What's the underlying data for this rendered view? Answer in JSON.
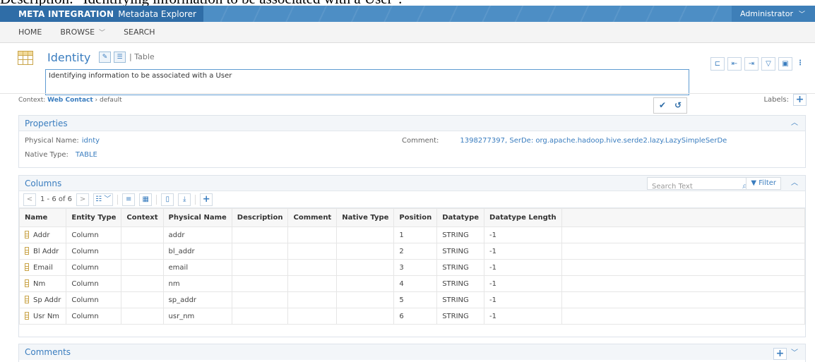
{
  "cropped_caption": "Description: \"Identifying information to be associated with a User\".",
  "app": {
    "brand_strong": "META INTEGRATION",
    "brand_sub": "Metadata Explorer",
    "user": "Administrator"
  },
  "nav": {
    "home": "HOME",
    "browse": "BROWSE",
    "search": "SEARCH"
  },
  "header": {
    "title": "Identity",
    "type_label": "| Table",
    "description": "Identifying information to be associated with a User",
    "context_prefix": "Context:",
    "context_link": "Web Contact",
    "context_suffix": "› default",
    "labels": "Labels:"
  },
  "properties": {
    "heading": "Properties",
    "physical_name_label": "Physical Name:",
    "physical_name": "idnty",
    "native_type_label": "Native Type:",
    "native_type": "TABLE",
    "comment_label": "Comment:",
    "comment": "1398277397, SerDe: org.apache.hadoop.hive.serde2.lazy.LazySimpleSerDe"
  },
  "columns": {
    "heading": "Columns",
    "search_placeholder": "Search Text",
    "filter_label": "Filter",
    "pager": "1 - 6 of 6",
    "headers": [
      "Name",
      "Entity Type",
      "Context",
      "Physical Name",
      "Description",
      "Comment",
      "Native Type",
      "Position",
      "Datatype",
      "Datatype Length"
    ],
    "rows": [
      {
        "name": "Addr",
        "entity_type": "Column",
        "context": "",
        "physical": "addr",
        "description": "",
        "comment": "",
        "native_type": "",
        "position": "1",
        "datatype": "STRING",
        "length": "-1"
      },
      {
        "name": "Bl Addr",
        "entity_type": "Column",
        "context": "",
        "physical": "bl_addr",
        "description": "",
        "comment": "",
        "native_type": "",
        "position": "2",
        "datatype": "STRING",
        "length": "-1"
      },
      {
        "name": "Email",
        "entity_type": "Column",
        "context": "",
        "physical": "email",
        "description": "",
        "comment": "",
        "native_type": "",
        "position": "3",
        "datatype": "STRING",
        "length": "-1"
      },
      {
        "name": "Nm",
        "entity_type": "Column",
        "context": "",
        "physical": "nm",
        "description": "",
        "comment": "",
        "native_type": "",
        "position": "4",
        "datatype": "STRING",
        "length": "-1"
      },
      {
        "name": "Sp Addr",
        "entity_type": "Column",
        "context": "",
        "physical": "sp_addr",
        "description": "",
        "comment": "",
        "native_type": "",
        "position": "5",
        "datatype": "STRING",
        "length": "-1"
      },
      {
        "name": "Usr Nm",
        "entity_type": "Column",
        "context": "",
        "physical": "usr_nm",
        "description": "",
        "comment": "",
        "native_type": "",
        "position": "6",
        "datatype": "STRING",
        "length": "-1"
      }
    ]
  },
  "comments": {
    "heading": "Comments"
  },
  "colors": {
    "topbar": "#4d8ec5",
    "brand_bg": "#2f6da7",
    "accent": "#3a7dbf",
    "icon_gold": "#c9a449"
  }
}
